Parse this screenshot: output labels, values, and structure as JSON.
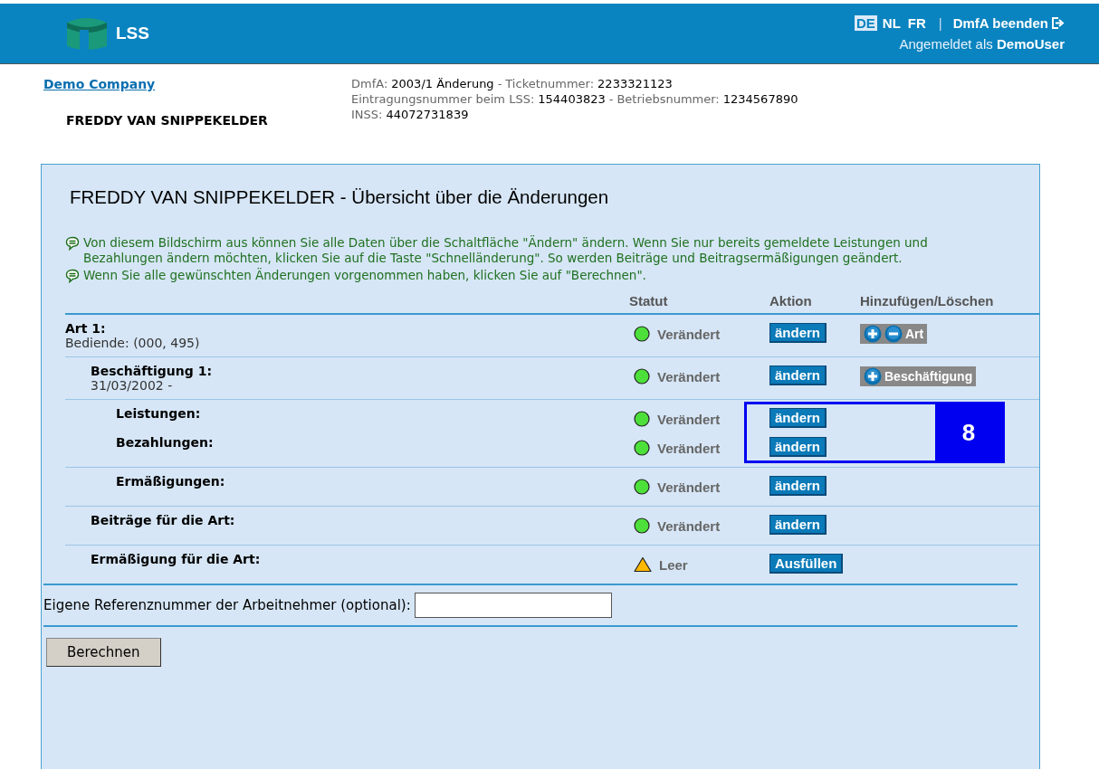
{
  "header": {
    "logo_text": "LSS",
    "languages": [
      {
        "label": "DE",
        "selected": true
      },
      {
        "label": "NL",
        "selected": false
      },
      {
        "label": "FR",
        "selected": false
      }
    ],
    "separator": "|",
    "exit_link": "DmfA beenden",
    "login": "Angemeldet als **DemoUser**"
  },
  "info": {
    "company_link": "Demo Company",
    "employee": "FREDDY VAN SNIPPEKELDER",
    "lines": [
      [
        {
          "label": "DmfA:",
          "value": "2003/1 Änderung"
        },
        {
          "sep": "-",
          "label": "Ticketnummer:",
          "value": "2233321123"
        }
      ],
      [
        {
          "label": "Eintragungsnummer beim LSS:",
          "value": "154403823"
        },
        {
          "sep": "-",
          "label": "Betriebsnummer:",
          "value": "1234567890"
        }
      ],
      [
        {
          "label": "INSS:",
          "value": "44072731839"
        }
      ]
    ]
  },
  "panel": {
    "title": "FREDDY VAN SNIPPEKELDER - Übersicht über die Änderungen",
    "notes": [
      "Von diesem Bildschirm aus können Sie alle Daten über die Schaltfläche \"Ändern\" ändern. Wenn Sie nur bereits gemeldete Leistungen und Bezahlungen ändern möchten, klicken Sie auf die Taste \"Schnelländerung\". So werden Beiträge und Beitragsermäßigungen geändert.",
      "Wenn Sie alle gewünschten Änderungen vorgenommen haben, klicken Sie auf \"Berechnen\"."
    ],
    "columns": [
      "Statut",
      "Aktion",
      "Hinzufügen/Löschen"
    ],
    "rows": [
      {
        "label": "Art 1",
        "suffix": ":",
        "sublabel": "Bediende: (000, 495)",
        "kind": "changed",
        "status_text": "Verändert",
        "action": "ändern",
        "add_remove": {
          "add": true,
          "remove": true,
          "label": "Art"
        },
        "children": [
          {
            "label": "Beschäftigung 1:",
            "sublabel": "31/03/2002 -",
            "kind": "changed",
            "status_text": "Verändert",
            "action": "ändern",
            "add_remove": {
              "add": true,
              "remove": false,
              "label": "Beschäftigung"
            },
            "children": [
              {
                "label": "Leistungen:",
                "kind": "changed",
                "status_text": "Verändert",
                "action": "ändern",
                "callout": "8"
              },
              {
                "label": "Bezahlungen:",
                "kind": "changed",
                "status_text": "Verändert",
                "action": "ändern",
                "joined": true
              },
              {
                "label": "Ermäßigungen:",
                "kind": "changed",
                "status_text": "Verändert",
                "action": "ändern"
              }
            ]
          },
          {
            "label": "Beiträge für die Art:",
            "kind": "changed",
            "status_text": "Verändert",
            "action": "ändern"
          },
          {
            "label": "Ermäßigung für die Art:",
            "kind": "empty",
            "status_text": "Leer",
            "action": "Ausfüllen"
          }
        ]
      }
    ],
    "reference": {
      "label": "Eigene Referenznummer der Arbeitnehmer (optional):"
    },
    "submit": "Berechnen"
  }
}
